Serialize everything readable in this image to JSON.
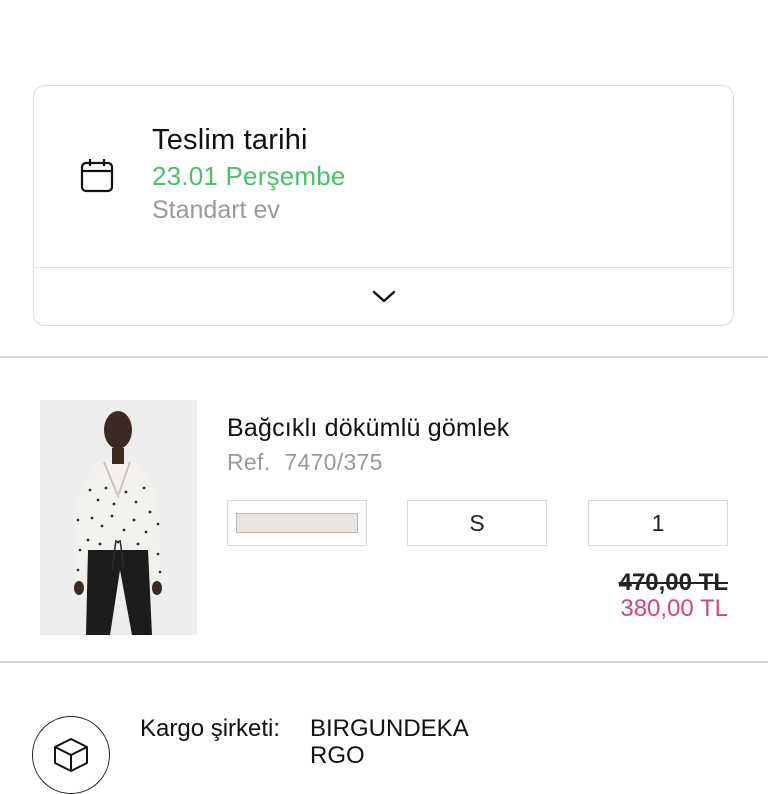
{
  "delivery": {
    "title": "Teslim tarihi",
    "date": "23.01 Perşembe",
    "method": "Standart ev",
    "date_color": "#4cbf6a",
    "icon": "calendar-icon",
    "expand_icon": "chevron-down-icon"
  },
  "product": {
    "name": "Bağcıklı dökümlü gömlek",
    "ref_label": "Ref.",
    "ref_number": "7470/375",
    "color_swatch": "#ebe5e2",
    "size": "S",
    "quantity": "1",
    "price_old": "470,00 TL",
    "price_new": "380,00 TL",
    "price_new_color": "#d6457a"
  },
  "shipping": {
    "label": "Kargo şirketi:",
    "company": "BIRGUNDEKARGO",
    "icon": "package-icon"
  }
}
